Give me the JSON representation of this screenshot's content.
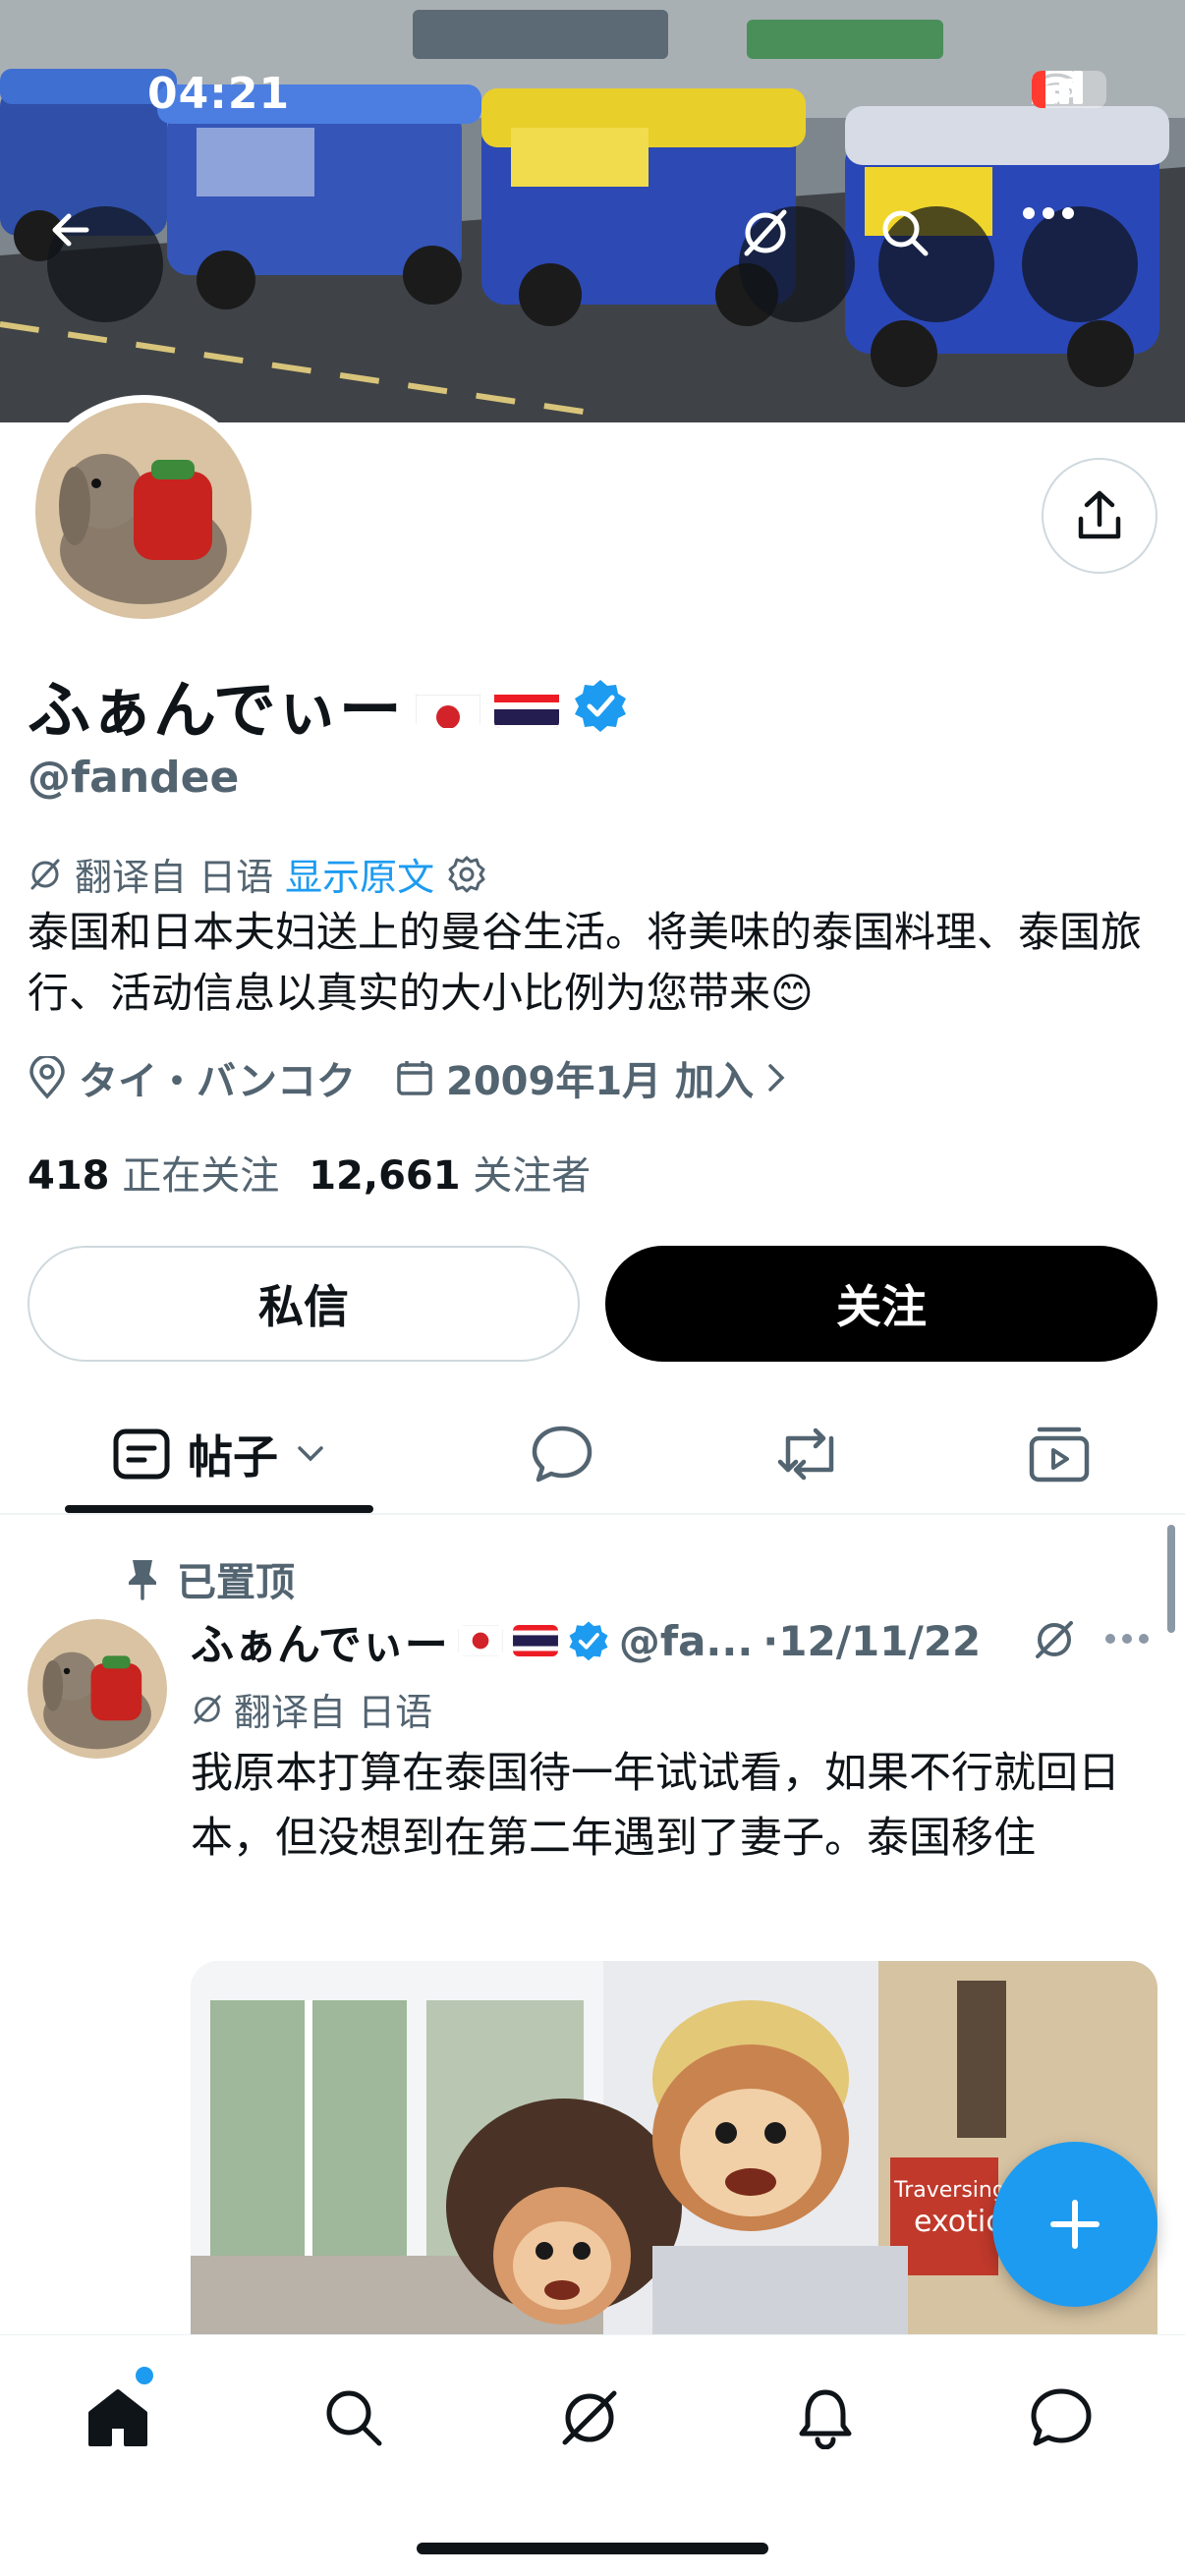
{
  "status_bar": {
    "time": "04:21",
    "battery": "6"
  },
  "profile": {
    "display_name": "ふぁんでぃー",
    "handle": "@fandee",
    "translated_label": "翻译自 日语",
    "show_original": "显示原文",
    "bio": "泰国和日本夫妇送上的曼谷生活。将美味的泰国料理、泰国旅行、活动信息以真实的大小比例为您带来😊",
    "location": "タイ・バンコク",
    "joined": "2009年1月 加入",
    "following_count": "418",
    "following_label": "正在关注",
    "followers_count": "12,661",
    "followers_label": "关注者"
  },
  "actions": {
    "dm_label": "私信",
    "follow_label": "关注"
  },
  "tabs": {
    "posts_label": "帖子"
  },
  "post": {
    "pinned_label": "已置顶",
    "author_name": "ふぁんでぃー",
    "author_handle": "@fa...",
    "date": "·12/11/22",
    "translated_label": "翻译自 日语",
    "text": "我原本打算在泰国待一年试试看，如果不行就回日本，但没想到在第二年遇到了妻子。泰国移住",
    "media_book_text": "Traversing",
    "media_book_text2": "exotic"
  },
  "icons": {
    "back": "arrow-left-icon",
    "grok": "grok-icon",
    "search": "search-icon",
    "more": "more-icon",
    "share": "share-icon",
    "verified": "verified-badge-icon",
    "location": "location-pin-icon",
    "calendar": "calendar-icon",
    "settings": "gear-icon",
    "pin": "pin-icon",
    "compose": "plus-icon"
  },
  "colors": {
    "accent": "#1d9bf0",
    "text": "#0f1419",
    "muted": "#536471",
    "border": "#cfd9de"
  }
}
